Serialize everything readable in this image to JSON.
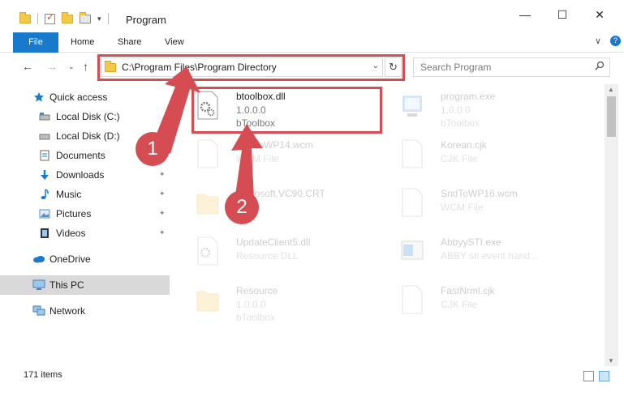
{
  "window": {
    "title": "Program",
    "controls": {
      "minimize": "—",
      "maximize": "☐",
      "close": "✕"
    }
  },
  "ribbon": {
    "tabs": [
      "File",
      "Home",
      "Share",
      "View"
    ],
    "collapse": "∨",
    "help": "?"
  },
  "nav": {
    "back": "←",
    "forward": "→",
    "up": "↑",
    "recent": "⌄"
  },
  "address": {
    "path": "C:\\Program Files\\Program Directory",
    "chevron": "⌄",
    "refresh": "↻"
  },
  "search": {
    "placeholder": "Search Program",
    "icon": "search-icon"
  },
  "sidebar": {
    "items": [
      {
        "label": "Quick access",
        "icon": "star-icon",
        "pinned": false
      },
      {
        "label": "Local Disk (C:)",
        "icon": "drive-icon",
        "pinned": false
      },
      {
        "label": "Local Disk (D:)",
        "icon": "drive-icon",
        "pinned": false
      },
      {
        "label": "Documents",
        "icon": "documents-icon",
        "pinned": true
      },
      {
        "label": "Downloads",
        "icon": "downloads-icon",
        "pinned": true
      },
      {
        "label": "Music",
        "icon": "music-icon",
        "pinned": true
      },
      {
        "label": "Pictures",
        "icon": "pictures-icon",
        "pinned": true
      },
      {
        "label": "Videos",
        "icon": "videos-icon",
        "pinned": true
      },
      {
        "label": "OneDrive",
        "icon": "onedrive-icon",
        "pinned": false
      },
      {
        "label": "This PC",
        "icon": "computer-icon",
        "pinned": false,
        "selected": true
      },
      {
        "label": "Network",
        "icon": "network-icon",
        "pinned": false
      }
    ],
    "pin_glyph": "📌"
  },
  "files": [
    {
      "name": "btoolbox.dll",
      "meta1": "1.0.0.0",
      "meta2": "bToolbox",
      "icon": "dll-gear-icon",
      "highlighted": true
    },
    {
      "name": "program.exe",
      "meta1": "1.0.0.0",
      "meta2": "bToolbox",
      "icon": "exe-icon",
      "highlighted": false
    },
    {
      "name": "SndToWP14.wcm",
      "meta1": "WCM File",
      "meta2": "",
      "icon": "blank-file-icon",
      "highlighted": false
    },
    {
      "name": "Korean.cjk",
      "meta1": "CJK File",
      "meta2": "",
      "icon": "blank-file-icon",
      "highlighted": false
    },
    {
      "name": "Microsoft.VC90.CRT",
      "meta1": "",
      "meta2": "",
      "icon": "folder-icon",
      "highlighted": false
    },
    {
      "name": "SndToWP16.wcm",
      "meta1": "WCM File",
      "meta2": "",
      "icon": "blank-file-icon",
      "highlighted": false
    },
    {
      "name": "UpdateClient5.dll",
      "meta1": "Resource DLL",
      "meta2": "",
      "icon": "dll-gear-icon",
      "highlighted": false
    },
    {
      "name": "AbbyySTI.exe",
      "meta1": "ABBY sti event hand...",
      "meta2": "",
      "icon": "exe-icon",
      "highlighted": false
    },
    {
      "name": "Resource",
      "meta1": "1.0.0.0",
      "meta2": "bToolbox",
      "icon": "folder-icon",
      "highlighted": false
    },
    {
      "name": "FastNrml.cjk",
      "meta1": "CJK File",
      "meta2": "",
      "icon": "blank-file-icon",
      "highlighted": false
    }
  ],
  "callouts": [
    "1",
    "2"
  ],
  "status": {
    "count": "171 items"
  },
  "colors": {
    "accent": "#1979ca",
    "highlight": "#d54d52",
    "selected_nav": "#d9d9d9"
  }
}
